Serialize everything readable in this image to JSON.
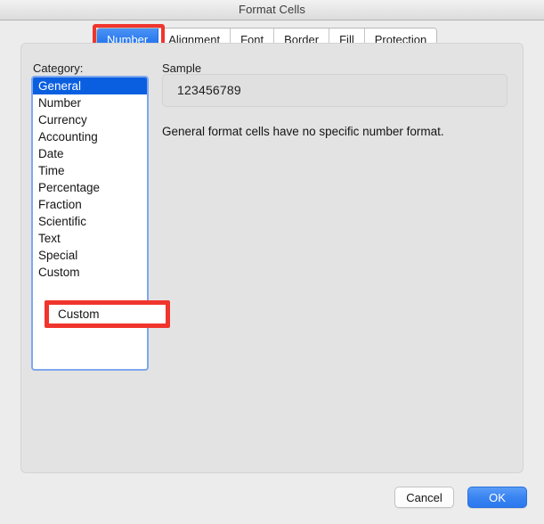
{
  "window": {
    "title": "Format Cells"
  },
  "tabs": [
    {
      "label": "Number",
      "selected": true,
      "highlighted": true
    },
    {
      "label": "Alignment",
      "selected": false,
      "highlighted": false
    },
    {
      "label": "Font",
      "selected": false,
      "highlighted": false
    },
    {
      "label": "Border",
      "selected": false,
      "highlighted": false
    },
    {
      "label": "Fill",
      "selected": false,
      "highlighted": false
    },
    {
      "label": "Protection",
      "selected": false,
      "highlighted": false
    }
  ],
  "category": {
    "label": "Category:",
    "items": [
      {
        "label": "General",
        "selected": true
      },
      {
        "label": "Number",
        "selected": false
      },
      {
        "label": "Currency",
        "selected": false
      },
      {
        "label": "Accounting",
        "selected": false
      },
      {
        "label": "Date",
        "selected": false
      },
      {
        "label": "Time",
        "selected": false
      },
      {
        "label": "Percentage",
        "selected": false
      },
      {
        "label": "Fraction",
        "selected": false
      },
      {
        "label": "Scientific",
        "selected": false
      },
      {
        "label": "Text",
        "selected": false
      },
      {
        "label": "Special",
        "selected": false
      },
      {
        "label": "Custom",
        "selected": false
      }
    ],
    "highlighted_item": "Custom"
  },
  "sample": {
    "label": "Sample",
    "value": "123456789"
  },
  "description": "General format cells have no specific number format.",
  "footer": {
    "cancel_label": "Cancel",
    "ok_label": "OK"
  },
  "colors": {
    "accent_blue": "#2f7df0",
    "selection_blue": "#0a5fe0",
    "annotation_red": "#f0352c",
    "listbox_border": "#7fa7ef",
    "panel_bg": "#e3e3e3",
    "window_bg": "#ececec"
  }
}
